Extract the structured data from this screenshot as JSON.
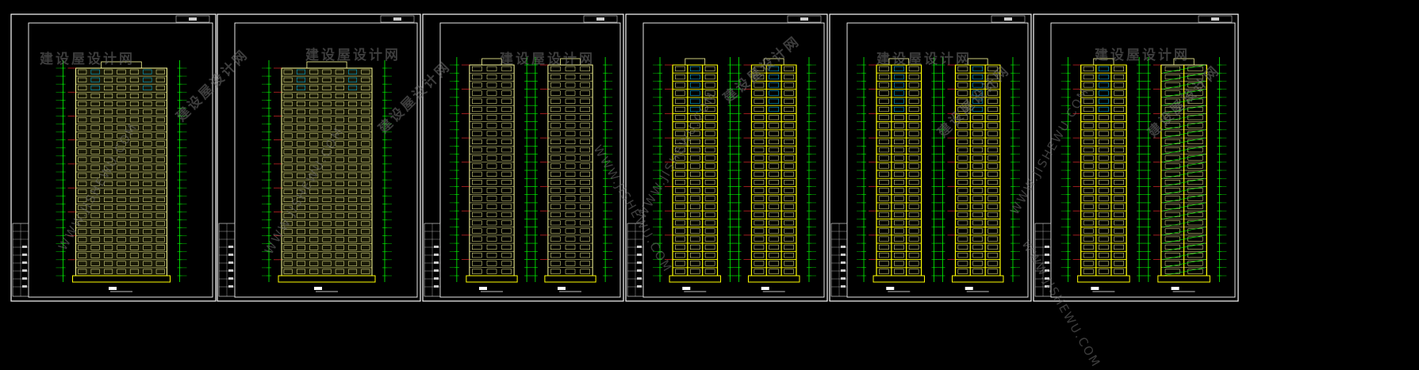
{
  "watermark": {
    "cn": "建设屋设计网",
    "en": "WWW.JISHEWU.COM"
  },
  "sheets": [
    {
      "views": [
        {
          "kind": "front",
          "bays": 7
        }
      ]
    },
    {
      "views": [
        {
          "kind": "front",
          "bays": 7
        }
      ]
    },
    {
      "views": [
        {
          "kind": "side",
          "bays": 3
        },
        {
          "kind": "side",
          "bays": 3
        }
      ]
    },
    {
      "views": [
        {
          "kind": "section",
          "bays": 3
        },
        {
          "kind": "section",
          "bays": 3
        }
      ]
    },
    {
      "views": [
        {
          "kind": "section",
          "bays": 3
        },
        {
          "kind": "section",
          "bays": 3
        }
      ]
    },
    {
      "views": [
        {
          "kind": "section",
          "bays": 3
        },
        {
          "kind": "stair",
          "bays": 2
        }
      ]
    }
  ],
  "floors": 26,
  "colors": {
    "background": "#000000",
    "frame": "#ffffff",
    "dimension": "#00ff00",
    "facade": "#ffff99",
    "window": "#00c8ff",
    "level": "#ff3030",
    "slab": "#ffff00",
    "titleblock": "#cccccc"
  }
}
